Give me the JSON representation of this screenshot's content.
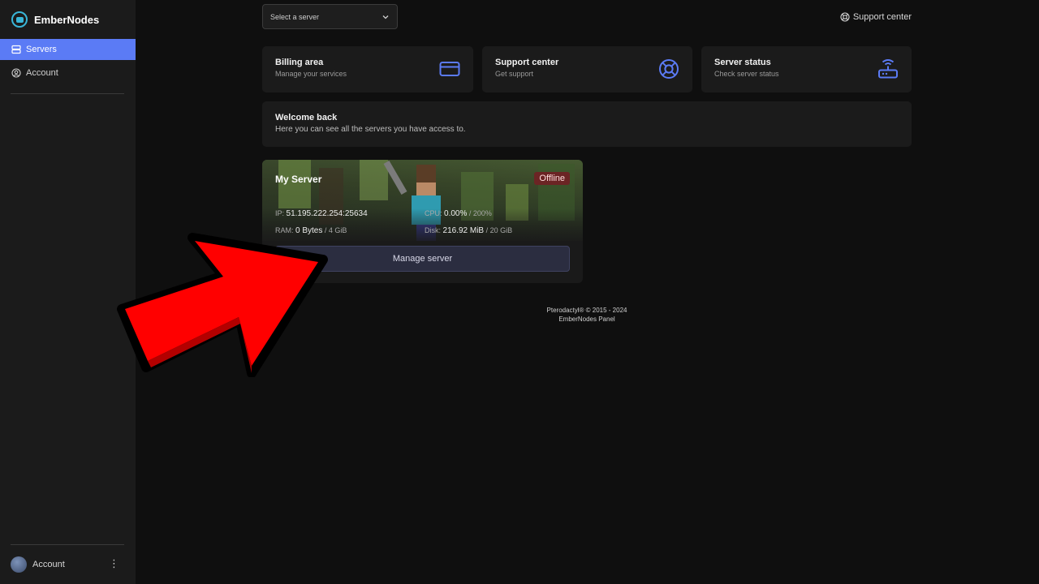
{
  "brand": {
    "name": "EmberNodes"
  },
  "sidebar": {
    "items": [
      {
        "label": "Servers",
        "icon": "server-icon",
        "active": true
      },
      {
        "label": "Account",
        "icon": "user-circle-icon",
        "active": false
      }
    ],
    "user": {
      "label": "Account",
      "menu_icon": "more-vertical-icon"
    }
  },
  "topbar": {
    "server_select": {
      "placeholder": "Select a server",
      "icon": "chevron-down-icon"
    },
    "support_link": {
      "label": "Support center",
      "icon": "lifebuoy-icon"
    }
  },
  "cards": [
    {
      "title": "Billing area",
      "subtitle": "Manage your services",
      "icon": "credit-card-icon"
    },
    {
      "title": "Support center",
      "subtitle": "Get support",
      "icon": "lifebuoy-icon"
    },
    {
      "title": "Server status",
      "subtitle": "Check server status",
      "icon": "router-icon"
    }
  ],
  "welcome": {
    "title": "Welcome back",
    "subtitle": "Here you can see all the servers you have access to."
  },
  "server": {
    "name": "My Server",
    "status": "Offline",
    "ip_label": "IP:",
    "ip": "51.195.222.254:25634",
    "cpu_label": "CPU:",
    "cpu_used": "0.00%",
    "cpu_total": "/ 200%",
    "ram_label": "RAM:",
    "ram_used": "0 Bytes",
    "ram_total": "/ 4 GiB",
    "disk_label": "Disk:",
    "disk_used": "216.92 MiB",
    "disk_total": "/ 20 GiB",
    "manage_label": "Manage server"
  },
  "footer": {
    "line1": "Pterodactyl® © 2015 - 2024",
    "line2": "EmberNodes Panel"
  },
  "colors": {
    "accent": "#5b7bf5",
    "brand_cyan": "#39b6d8",
    "offline_badge": "#6b2424",
    "arrow_red": "#ff0000"
  }
}
